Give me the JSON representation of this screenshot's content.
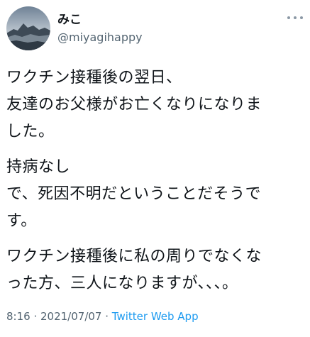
{
  "user": {
    "display_name": "みこ",
    "handle": "@miyagihappy",
    "avatar_icon": "avatar-landscape-icon"
  },
  "more_icon": "more-dots-icon",
  "tweet": {
    "paragraphs": [
      "ワクチン接種後の翌日、\n友達のお父様がお亡くなりになりま\nした。",
      "持病なし\nで、死因不明だということだそうで\nす。",
      "ワクチン接種後に私の周りでなくな\nった方、三人になりますが、、、。"
    ]
  },
  "meta": {
    "time": "8:16",
    "separator1": " · ",
    "date": "2021/07/07",
    "separator2": " · ",
    "source": "Twitter Web App"
  },
  "colors": {
    "text": "#0f1419",
    "secondary": "#536471",
    "link": "#1d9bf0"
  }
}
